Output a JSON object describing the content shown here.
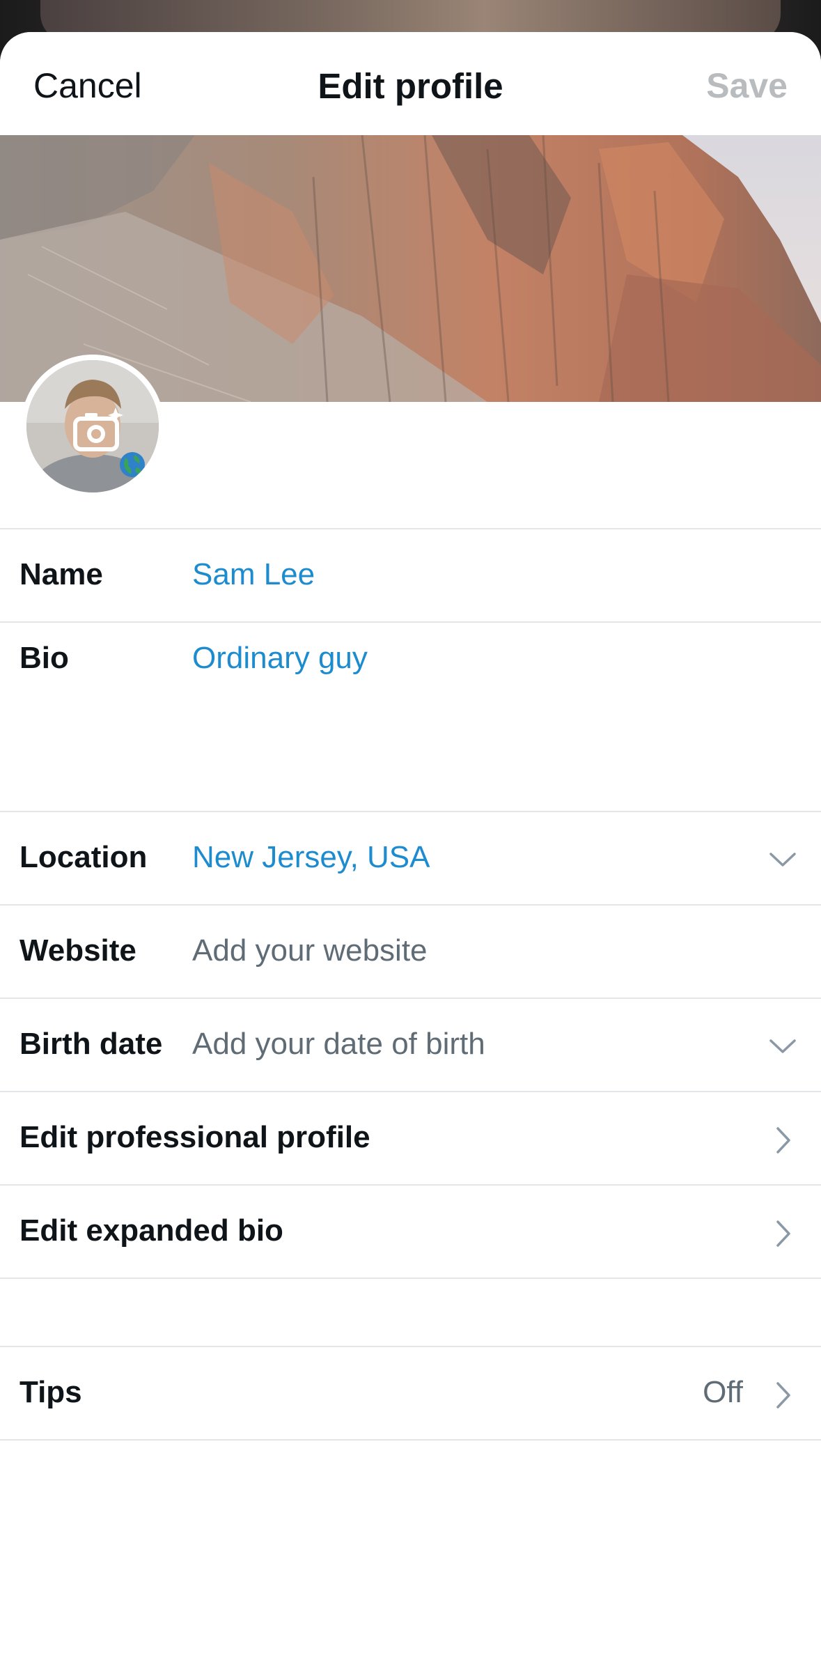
{
  "header": {
    "cancel_label": "Cancel",
    "title": "Edit profile",
    "save_label": "Save"
  },
  "fields": {
    "name": {
      "label": "Name",
      "value": "Sam Lee"
    },
    "bio": {
      "label": "Bio",
      "value": "Ordinary guy"
    },
    "location": {
      "label": "Location",
      "value": "New Jersey, USA"
    },
    "website": {
      "label": "Website",
      "placeholder": "Add your website"
    },
    "birth_date": {
      "label": "Birth date",
      "placeholder": "Add your date of birth"
    }
  },
  "links": {
    "professional": {
      "label": "Edit professional profile"
    },
    "expanded_bio": {
      "label": "Edit expanded bio"
    }
  },
  "tips": {
    "label": "Tips",
    "value": "Off"
  },
  "icons": {
    "avatar_camera": "camera-sparkle-icon",
    "avatar_badge": "globe-icon",
    "dropdown": "chevron-down-icon",
    "disclosure": "chevron-right-icon"
  },
  "colors": {
    "accent": "#1d8ccf",
    "text": "#0f1419",
    "muted": "#5f6b75",
    "save_disabled": "#b9bcbf",
    "divider": "#e4e7ea"
  }
}
